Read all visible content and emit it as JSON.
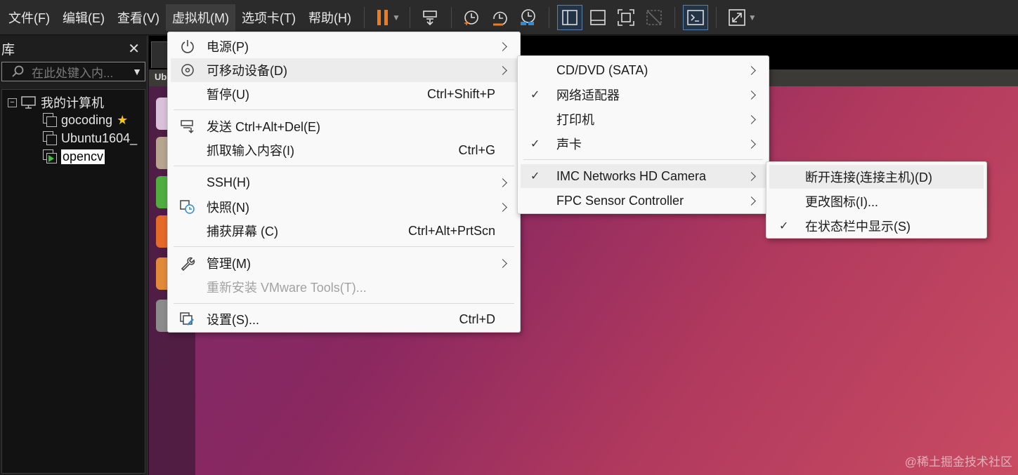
{
  "menubar": {
    "items": [
      "文件(F)",
      "编辑(E)",
      "查看(V)",
      "虚拟机(M)",
      "选项卡(T)",
      "帮助(H)"
    ]
  },
  "toolbar": {
    "icons": [
      "pause-icon",
      "send-ctrl-alt-del-icon",
      "snapshot-take-icon",
      "snapshot-revert-icon",
      "snapshot-manager-icon",
      "view-library-icon",
      "view-thumbnail-icon",
      "fullscreen-icon",
      "unity-icon",
      "console-icon",
      "stretch-icon"
    ],
    "accent": "#f07b1d"
  },
  "library": {
    "title": "库",
    "search_placeholder": "在此处键入内...",
    "tree": {
      "root": "我的计算机",
      "vms": [
        "gocoding",
        "Ubuntu1604_",
        "opencv"
      ],
      "selected": "opencv"
    }
  },
  "vm_screen": {
    "top_bar_text": "Ub"
  },
  "vm_menu": {
    "items": [
      {
        "label": "电源(P)",
        "shortcut": "",
        "icon": "power-icon"
      },
      {
        "label": "可移动设备(D)",
        "shortcut": "",
        "icon": "disc-icon"
      },
      {
        "label": "暂停(U)",
        "shortcut": "Ctrl+Shift+P",
        "icon": ""
      },
      {
        "label": "发送 Ctrl+Alt+Del(E)",
        "shortcut": "",
        "icon": "send-keys-icon"
      },
      {
        "label": "抓取输入内容(I)",
        "shortcut": "Ctrl+G",
        "icon": ""
      },
      {
        "label": "SSH(H)",
        "shortcut": "",
        "icon": ""
      },
      {
        "label": "快照(N)",
        "shortcut": "",
        "icon": "snapshot-icon"
      },
      {
        "label": "捕获屏幕 (C)",
        "shortcut": "Ctrl+Alt+PrtScn",
        "icon": ""
      },
      {
        "label": "管理(M)",
        "shortcut": "",
        "icon": "wrench-icon"
      },
      {
        "label": "重新安装 VMware Tools(T)...",
        "shortcut": "",
        "icon": ""
      },
      {
        "label": "设置(S)...",
        "shortcut": "Ctrl+D",
        "icon": "settings-icon"
      }
    ]
  },
  "devices_menu": {
    "items": [
      {
        "label": "CD/DVD (SATA)",
        "checked": false
      },
      {
        "label": "网络适配器",
        "checked": true
      },
      {
        "label": "打印机",
        "checked": false
      },
      {
        "label": "声卡",
        "checked": true
      },
      {
        "label": "IMC Networks HD Camera",
        "checked": true
      },
      {
        "label": "FPC Sensor Controller",
        "checked": false
      }
    ]
  },
  "camera_menu": {
    "items": [
      {
        "label": "断开连接(连接主机)(D)",
        "checked": false
      },
      {
        "label": "更改图标(I)...",
        "checked": false
      },
      {
        "label": "在状态栏中显示(S)",
        "checked": true
      }
    ]
  },
  "watermark": "@稀土掘金技术社区"
}
